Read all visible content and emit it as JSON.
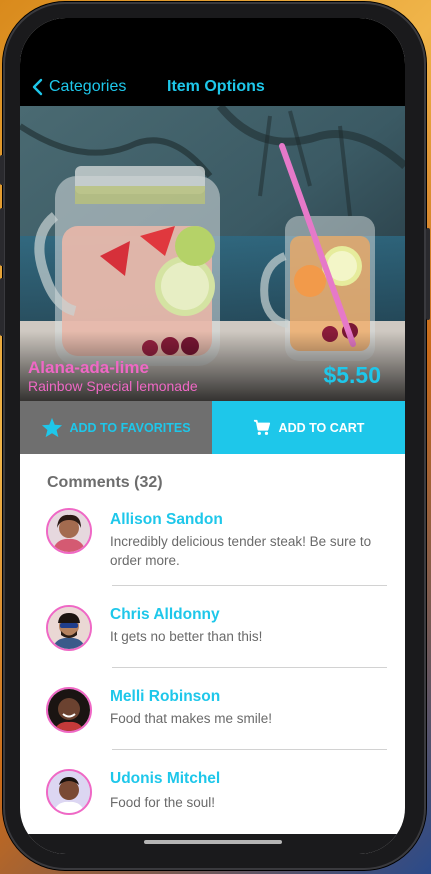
{
  "nav": {
    "back_label": "Categories",
    "title": "Item Options"
  },
  "item": {
    "name": "Alana-ada-lime",
    "subtitle": "Rainbow Special lemonade",
    "price": "$5.50"
  },
  "actions": {
    "favorites_label": "ADD TO FAVORITES",
    "cart_label": "ADD TO CART"
  },
  "comments": {
    "title": "Comments (32)",
    "items": [
      {
        "name": "Allison Sandon",
        "text": "Incredibly delicious tender steak! Be sure to order more."
      },
      {
        "name": "Chris Alldonny",
        "text": "It gets no better than this!"
      },
      {
        "name": "Melli Robinson",
        "text": "Food that makes me smile!"
      },
      {
        "name": "Udonis Mitchel",
        "text": "Food for the soul!"
      }
    ]
  },
  "colors": {
    "accent": "#1ec7ea",
    "pink": "#ef68c5",
    "favorites_bg": "#6f6f6f",
    "text_gray": "#6a6a6a"
  },
  "icons": {
    "back": "chevron-left-icon",
    "favorites": "star-icon",
    "cart": "cart-icon"
  }
}
